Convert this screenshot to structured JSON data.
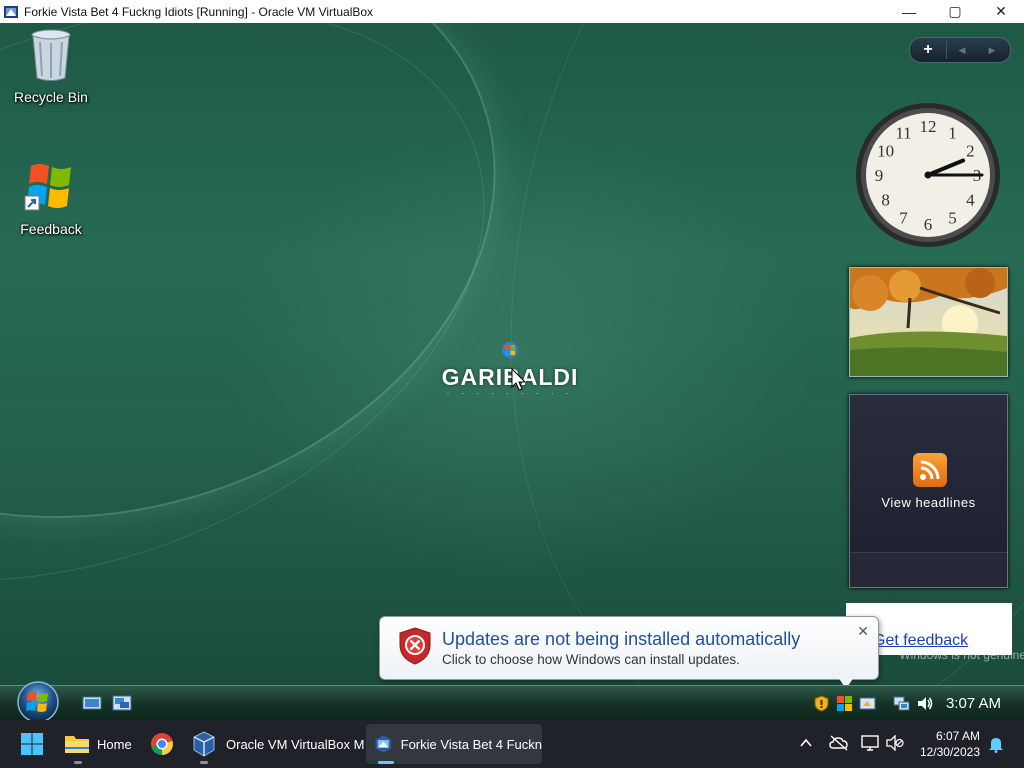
{
  "host_window": {
    "title": "Forkie Vista Bet 4 Fuckng Idiots [Running] - Oracle VM VirtualBox",
    "controls": {
      "minimize": "—",
      "maximize": "▢",
      "close": "✕"
    }
  },
  "desktop": {
    "icons": [
      {
        "label": "Recycle Bin",
        "icon": "recycle-bin-icon"
      },
      {
        "label": "Feedback",
        "icon": "windows-flag-shortcut-icon"
      }
    ],
    "brand": {
      "name": "GARIBALDI"
    }
  },
  "sidebar": {
    "controls": {
      "add": "+",
      "prev": "◀",
      "next": "▶"
    },
    "clock": {
      "numbers": [
        "12",
        "1",
        "2",
        "3",
        "4",
        "5",
        "6",
        "7",
        "8",
        "9",
        "10",
        "11"
      ],
      "hour": 2,
      "minute": 15
    },
    "slideshow": {
      "icon": "autumn-tree-photo"
    },
    "feeds": {
      "headline": "View headlines",
      "icon": "rss-icon"
    }
  },
  "feedback_popup": {
    "link": "Get feedback"
  },
  "watermark": {
    "line1": "Windows is not genuine"
  },
  "balloon": {
    "title": "Updates are not being installed automatically",
    "body": "Click to choose how Windows can install updates.",
    "close": "✕",
    "icon": "security-shield-error-icon"
  },
  "vista_taskbar": {
    "clock": "3:07 AM",
    "quicklaunch": [
      "show-desktop-icon",
      "switch-windows-icon"
    ],
    "tray": [
      "security-warning-icon",
      "windows-update-icon",
      "network-icon",
      "volume-icon"
    ]
  },
  "host_taskbar": {
    "items": [
      {
        "label": "",
        "icon": "windows-start-icon"
      },
      {
        "label": "Home",
        "icon": "file-explorer-icon"
      },
      {
        "label": "",
        "icon": "chrome-icon"
      },
      {
        "label": "Oracle VM VirtualBox M",
        "icon": "virtualbox-icon"
      },
      {
        "label": "Forkie Vista Bet 4 Fuckn",
        "icon": "vista-vm-icon"
      }
    ],
    "time": "6:07 AM",
    "date": "12/30/2023",
    "tray": [
      "chevron-up-icon",
      "onedrive-off-icon",
      "display-icon",
      "volume-muted-icon",
      "notification-bell-icon"
    ]
  },
  "colors": {
    "balloon_title": "#1f4f9e",
    "link": "#1b3fb0",
    "desktop": "#276b54"
  }
}
